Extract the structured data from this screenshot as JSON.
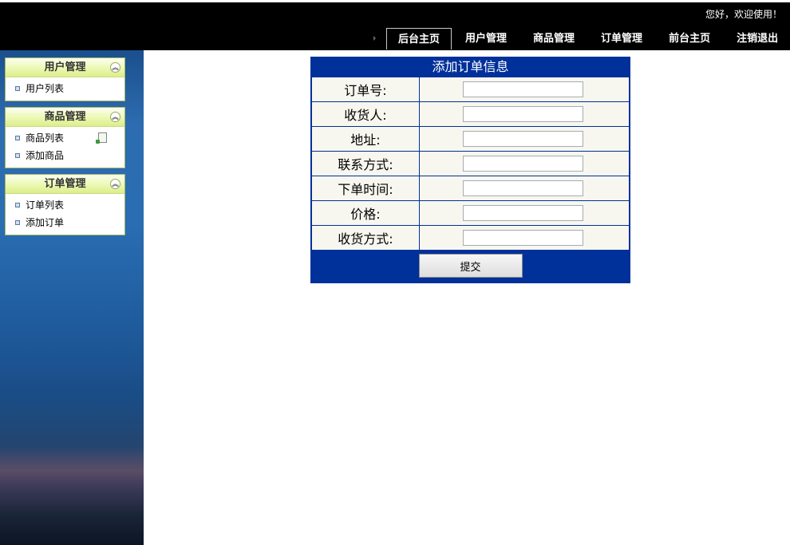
{
  "header": {
    "greeting": "您好，欢迎使用！",
    "nav": [
      {
        "label": "后台主页",
        "active": true
      },
      {
        "label": "用户管理"
      },
      {
        "label": "商品管理"
      },
      {
        "label": "订单管理"
      },
      {
        "label": "前台主页"
      },
      {
        "label": "注销退出"
      }
    ]
  },
  "sidebar": {
    "menus": [
      {
        "title": "用户管理",
        "items": [
          "用户列表"
        ]
      },
      {
        "title": "商品管理",
        "items": [
          "商品列表",
          "添加商品"
        ]
      },
      {
        "title": "订单管理",
        "items": [
          "订单列表",
          "添加订单"
        ]
      }
    ]
  },
  "form": {
    "title": "添加订单信息",
    "fields": [
      {
        "label": "订单号:",
        "value": ""
      },
      {
        "label": "收货人:",
        "value": ""
      },
      {
        "label": "地址:",
        "value": ""
      },
      {
        "label": "联系方式:",
        "value": ""
      },
      {
        "label": "下单时间:",
        "value": ""
      },
      {
        "label": "价格:",
        "value": ""
      },
      {
        "label": "收货方式:",
        "value": ""
      }
    ],
    "submit_label": "提交"
  },
  "colors": {
    "topbar": "#000000",
    "form_header": "#00309a",
    "form_cell": "#f8f7ef"
  }
}
